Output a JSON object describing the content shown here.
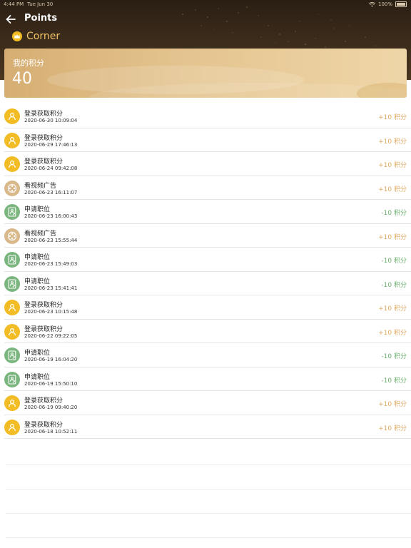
{
  "status_bar": {
    "time": "4:44 PM",
    "date": "Tue Jun 30",
    "battery": "100%"
  },
  "nav": {
    "title": "Points",
    "back_icon": "back-arrow-icon"
  },
  "brand": {
    "name": "Corner",
    "icon": "crown-icon"
  },
  "points_card": {
    "label": "我的积分",
    "value": "40"
  },
  "colors": {
    "header_dark": "#2a1f14",
    "card_gold": "#e4c48f",
    "plus": "#e0a861",
    "minus": "#6aaf6e",
    "login_icon_bg": "#f2bc25",
    "video_icon_bg": "#d9b88a",
    "apply_icon_bg": "#7bb67f"
  },
  "records": [
    {
      "type": "login",
      "title": "登录获取积分",
      "time": "2020-06-30 10:09:04",
      "points": "+10 积分",
      "sign": "plus"
    },
    {
      "type": "login",
      "title": "登录获取积分",
      "time": "2020-06-29 17:46:13",
      "points": "+10 积分",
      "sign": "plus"
    },
    {
      "type": "login",
      "title": "登录获取积分",
      "time": "2020-06-24 09:42:08",
      "points": "+10 积分",
      "sign": "plus"
    },
    {
      "type": "video",
      "title": "看视频广告",
      "time": "2020-06-23 16:11:07",
      "points": "+10 积分",
      "sign": "plus"
    },
    {
      "type": "apply",
      "title": "申请职位",
      "time": "2020-06-23 16:00:43",
      "points": "-10 积分",
      "sign": "minus"
    },
    {
      "type": "video",
      "title": "看视频广告",
      "time": "2020-06-23 15:55:44",
      "points": "+10 积分",
      "sign": "plus"
    },
    {
      "type": "apply",
      "title": "申请职位",
      "time": "2020-06-23 15:49:03",
      "points": "-10 积分",
      "sign": "minus"
    },
    {
      "type": "apply",
      "title": "申请职位",
      "time": "2020-06-23 15:41:41",
      "points": "-10 积分",
      "sign": "minus"
    },
    {
      "type": "login",
      "title": "登录获取积分",
      "time": "2020-06-23 10:15:48",
      "points": "+10 积分",
      "sign": "plus"
    },
    {
      "type": "login",
      "title": "登录获取积分",
      "time": "2020-06-22 09:22:05",
      "points": "+10 积分",
      "sign": "plus"
    },
    {
      "type": "apply",
      "title": "申请职位",
      "time": "2020-06-19 16:04:20",
      "points": "-10 积分",
      "sign": "minus"
    },
    {
      "type": "apply",
      "title": "申请职位",
      "time": "2020-06-19 15:50:10",
      "points": "-10 积分",
      "sign": "minus"
    },
    {
      "type": "login",
      "title": "登录获取积分",
      "time": "2020-06-19 09:40:20",
      "points": "+10 积分",
      "sign": "plus"
    },
    {
      "type": "login",
      "title": "登录获取积分",
      "time": "2020-06-18 10:52:11",
      "points": "+10 积分",
      "sign": "plus"
    }
  ]
}
